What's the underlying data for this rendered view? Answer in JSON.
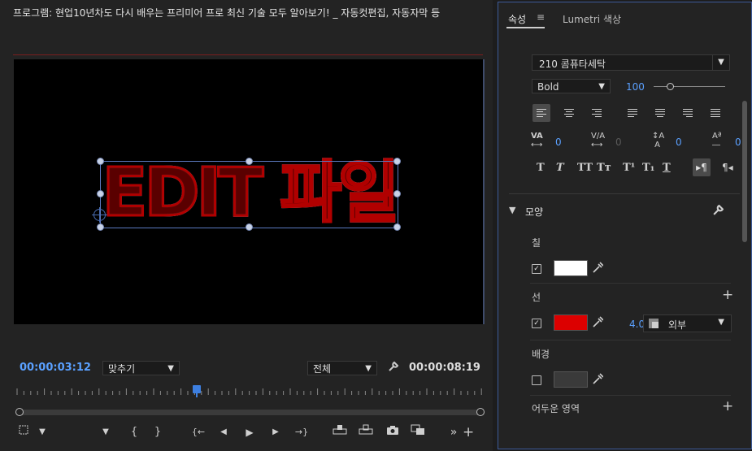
{
  "program_monitor": {
    "title": "프로그램: 현업10년차도 다시 배우는 프리미어 프로 최신 기술 모두 알아보기! _ 자동컷편집, 자동자막 등",
    "overlay_text": "EDIT 파일",
    "timecode": "00:00:03:12",
    "fit_label": "맞추기",
    "quality_label": "전체",
    "duration": "00:00:08:19",
    "transport": {
      "add_marker": "▼",
      "mark_in": "{",
      "mark_out": "}",
      "go_to_in": "{←",
      "step_back": "◀",
      "play": "▶",
      "step_forward": "▶",
      "go_to_out": "→}",
      "more": "»",
      "add": "+"
    }
  },
  "properties_panel": {
    "tabs": [
      {
        "label": "속성",
        "active": true
      },
      {
        "label": "Lumetri 색상",
        "active": false
      }
    ],
    "menu_icon": "≡",
    "font_family": "210 콤퓨타세탁",
    "font_weight": "Bold",
    "font_size": "100",
    "kerning": "0",
    "tracking": "0",
    "leading": "0",
    "baseline_shift": "0",
    "style_buttons": [
      "T",
      "T",
      "TT",
      "Tт",
      "T¹",
      "T₁",
      "T"
    ],
    "appearance": {
      "title": "모양",
      "fill_label": "칠",
      "fill_enabled": true,
      "fill_color": "#ffffff",
      "stroke_label": "선",
      "stroke_enabled": true,
      "stroke_color": "#dc0000",
      "stroke_width": "4.0",
      "stroke_type": "외부",
      "background_label": "배경",
      "background_enabled": false,
      "background_color": "#3a3a3a",
      "shadow_label": "어두운 영역"
    }
  },
  "icons": [
    "wrench-icon",
    "eyedropper-icon",
    "plus-icon",
    "chevron-down-icon",
    "hamburger-menu-icon",
    "camera-icon"
  ],
  "colors": {
    "accent_blue": "#5aa0ff",
    "panel_border": "#3c5a9a",
    "stroke_red": "#dc0000"
  }
}
